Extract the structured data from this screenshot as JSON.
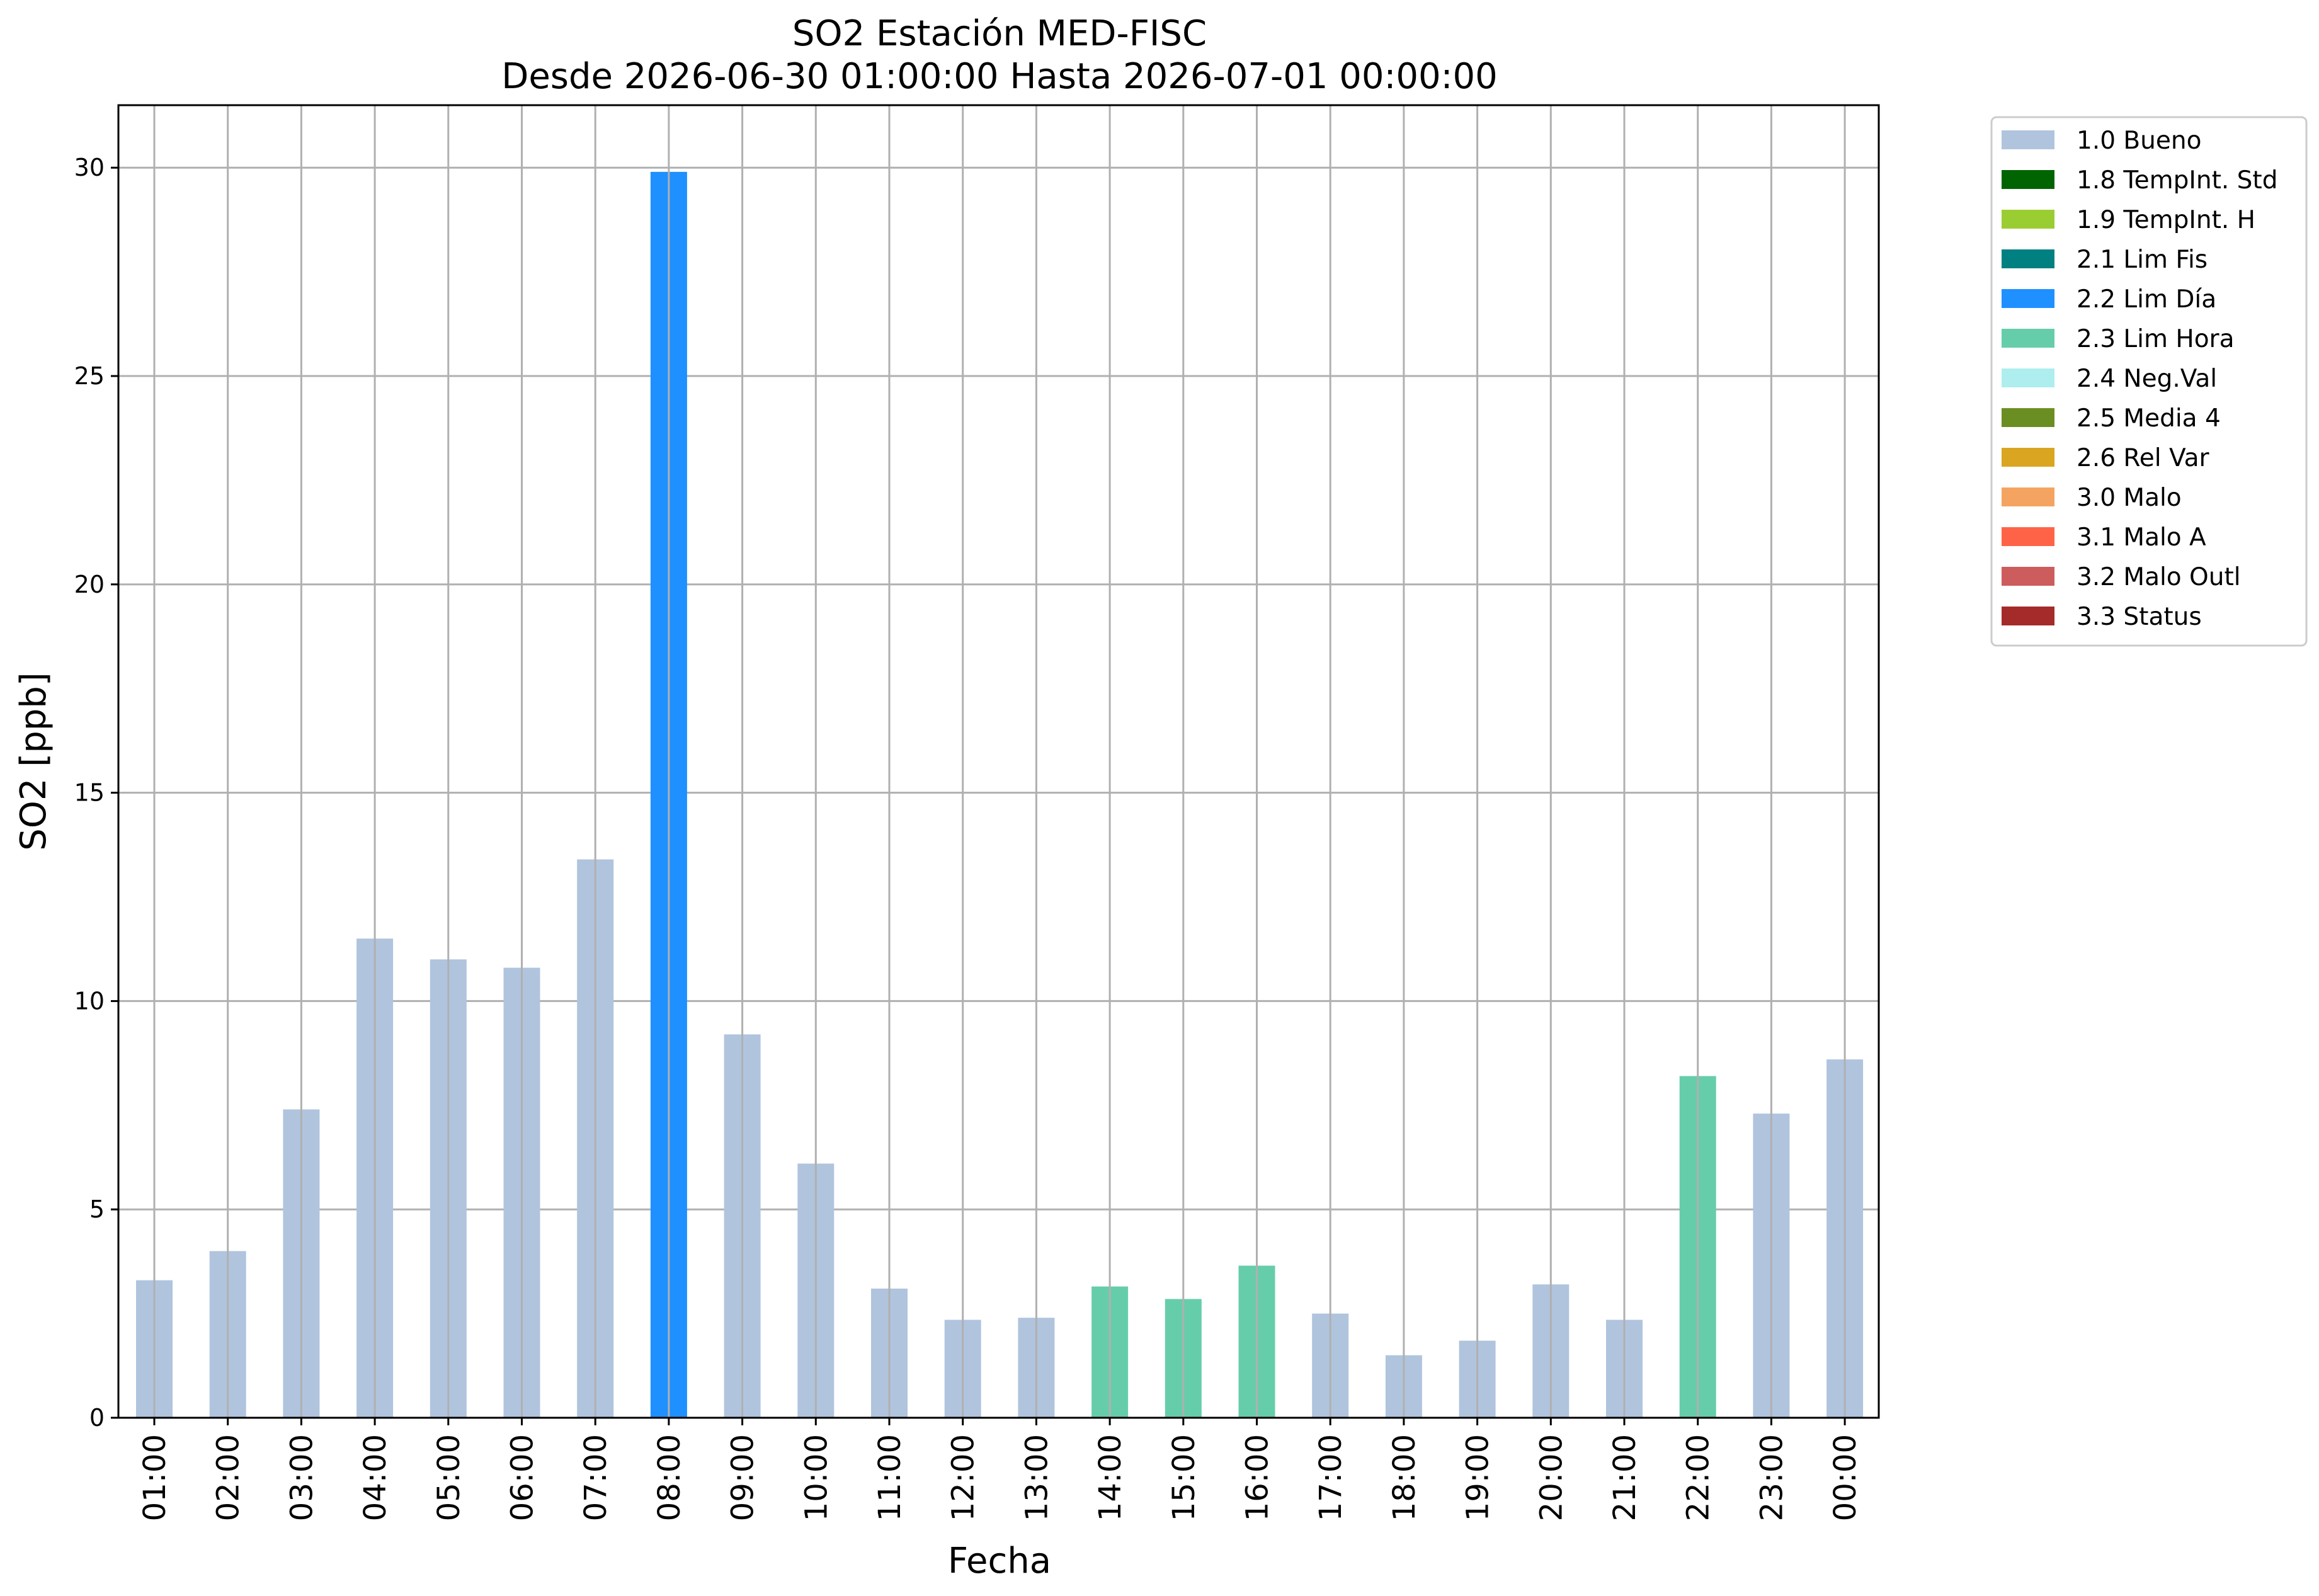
{
  "chart_data": {
    "type": "bar",
    "title": "SO2 Estación MED-FISC",
    "subtitle": "Desde 2026-06-30 01:00:00 Hasta 2026-07-01 00:00:00",
    "xlabel": "Fecha",
    "ylabel": "SO2 [ppb]",
    "ylim": [
      0,
      31.5
    ],
    "yticks": [
      0,
      5,
      10,
      15,
      20,
      25,
      30
    ],
    "grid": true,
    "legend_position": "outside-top-right",
    "categories": [
      "01:00",
      "02:00",
      "03:00",
      "04:00",
      "05:00",
      "06:00",
      "07:00",
      "08:00",
      "09:00",
      "10:00",
      "11:00",
      "12:00",
      "13:00",
      "14:00",
      "15:00",
      "16:00",
      "17:00",
      "18:00",
      "19:00",
      "20:00",
      "21:00",
      "22:00",
      "23:00",
      "00:00"
    ],
    "values": [
      3.3,
      4.0,
      7.4,
      11.5,
      11.0,
      10.8,
      13.4,
      29.9,
      9.2,
      6.1,
      3.1,
      2.35,
      2.4,
      3.15,
      2.85,
      3.65,
      2.5,
      1.5,
      1.85,
      3.2,
      2.35,
      8.2,
      7.3,
      8.6
    ],
    "flags": [
      "1.0",
      "1.0",
      "1.0",
      "1.0",
      "1.0",
      "1.0",
      "1.0",
      "2.2",
      "1.0",
      "1.0",
      "1.0",
      "1.0",
      "1.0",
      "2.3",
      "2.3",
      "2.3",
      "1.0",
      "1.0",
      "1.0",
      "1.0",
      "1.0",
      "2.3",
      "1.0",
      "1.0"
    ],
    "legend": [
      {
        "code": "1.0",
        "label": "1.0 Bueno",
        "color": "#b0c4de"
      },
      {
        "code": "1.8",
        "label": "1.8 TempInt. Std",
        "color": "#006400"
      },
      {
        "code": "1.9",
        "label": "1.9 TempInt. H",
        "color": "#9acd32"
      },
      {
        "code": "2.1",
        "label": "2.1 Lim Fis",
        "color": "#008080"
      },
      {
        "code": "2.2",
        "label": "2.2 Lim Día",
        "color": "#1e90ff"
      },
      {
        "code": "2.3",
        "label": "2.3 Lim Hora",
        "color": "#66cdaa"
      },
      {
        "code": "2.4",
        "label": "2.4 Neg.Val",
        "color": "#afeeee"
      },
      {
        "code": "2.5",
        "label": "2.5 Media 4",
        "color": "#6b8e23"
      },
      {
        "code": "2.6",
        "label": "2.6 Rel Var",
        "color": "#daa520"
      },
      {
        "code": "3.0",
        "label": "3.0 Malo",
        "color": "#f4a460"
      },
      {
        "code": "3.1",
        "label": "3.1 Malo A",
        "color": "#ff6347"
      },
      {
        "code": "3.2",
        "label": "3.2 Malo Outl",
        "color": "#cd5c5c"
      },
      {
        "code": "3.3",
        "label": "3.3 Status",
        "color": "#a52a2a"
      }
    ]
  }
}
